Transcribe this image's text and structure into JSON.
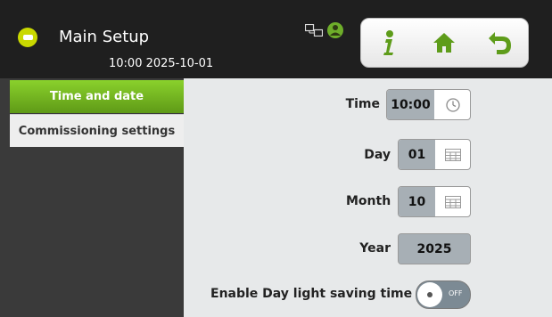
{
  "header": {
    "title": "Main Setup",
    "datetime": "10:00  2025-10-01",
    "icons": [
      "app-icon",
      "network-icon",
      "user-icon"
    ],
    "nav": [
      {
        "name": "info",
        "icon": "info-icon"
      },
      {
        "name": "home",
        "icon": "home-icon"
      },
      {
        "name": "back",
        "icon": "back-arrow-icon"
      }
    ]
  },
  "sidebar": {
    "items": [
      {
        "label": "Time and date",
        "active": true
      },
      {
        "label": "Commissioning settings",
        "active": false
      }
    ]
  },
  "form": {
    "time": {
      "label": "Time",
      "value": "10:00",
      "icon": "clock-icon"
    },
    "day": {
      "label": "Day",
      "value": "01",
      "icon": "calendar-icon"
    },
    "month": {
      "label": "Month",
      "value": "10",
      "icon": "calendar-icon"
    },
    "year": {
      "label": "Year",
      "value": "2025"
    },
    "dst": {
      "label": "Enable Day light saving time",
      "state": "OFF"
    }
  },
  "colors": {
    "accent_green": "#6eae2a",
    "field_bg": "#a7afb5",
    "content_bg": "#e7e9ea"
  }
}
